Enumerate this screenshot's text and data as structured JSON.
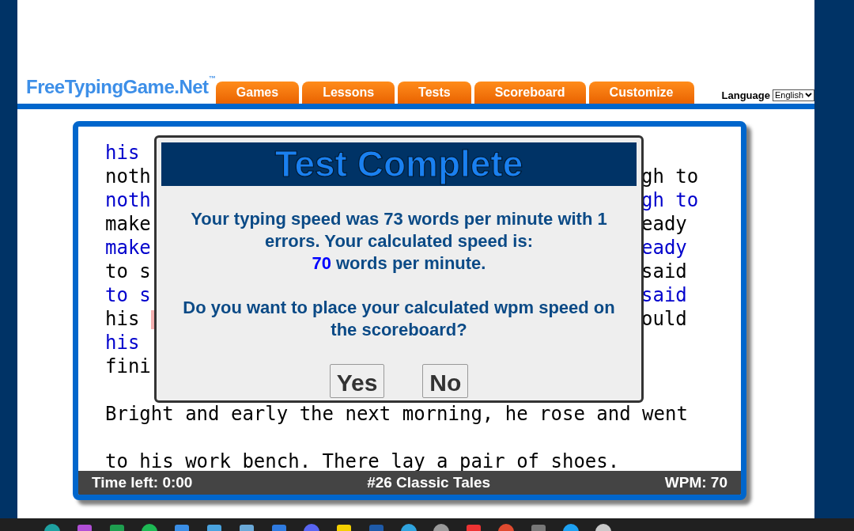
{
  "logo": {
    "name": "FreeTypingGame.Net",
    "mark": "™"
  },
  "tabs": [
    {
      "label": "Games"
    },
    {
      "label": "Lessons"
    },
    {
      "label": "Tests"
    },
    {
      "label": "Scoreboard"
    },
    {
      "label": "Customize"
    }
  ],
  "language": {
    "label": "Language",
    "value": "English"
  },
  "text_lines": [
    {
      "kind": "typed",
      "left": "his"
    },
    {
      "kind": "source",
      "left": "noth",
      "right": "gh to"
    },
    {
      "kind": "typed",
      "left": "noth",
      "right": "gh to"
    },
    {
      "kind": "source",
      "left": "make",
      "right": "eady"
    },
    {
      "kind": "typed",
      "left": "make",
      "right": "eady"
    },
    {
      "kind": "source",
      "left": "to s",
      "right": "said"
    },
    {
      "kind": "typed",
      "left": "to s",
      "right": "said"
    },
    {
      "kind": "source",
      "left": "his ",
      "error": true,
      "right": "ould"
    },
    {
      "kind": "typed",
      "left": "his"
    },
    {
      "kind": "source",
      "left": "fini"
    },
    {
      "kind": "blank"
    },
    {
      "kind": "source",
      "left": "Bright and early the next morning, he rose and went"
    },
    {
      "kind": "blank"
    },
    {
      "kind": "source",
      "left": "to his work bench. There lay a pair of shoes."
    }
  ],
  "status_bar": {
    "time_left": "Time left: 0:00",
    "test_name": "#26 Classic Tales",
    "wpm": "WPM: 70"
  },
  "dialog": {
    "title": "Test Complete",
    "result": "Your typing speed was 73 words per minute with 1 errors. Your calculated speed is:",
    "calculated_value": "70",
    "calculated_suffix": "words per minute.",
    "question": "Do you want to place your calculated wpm speed on the scoreboard?",
    "buttons": [
      "Yes",
      "No"
    ]
  }
}
